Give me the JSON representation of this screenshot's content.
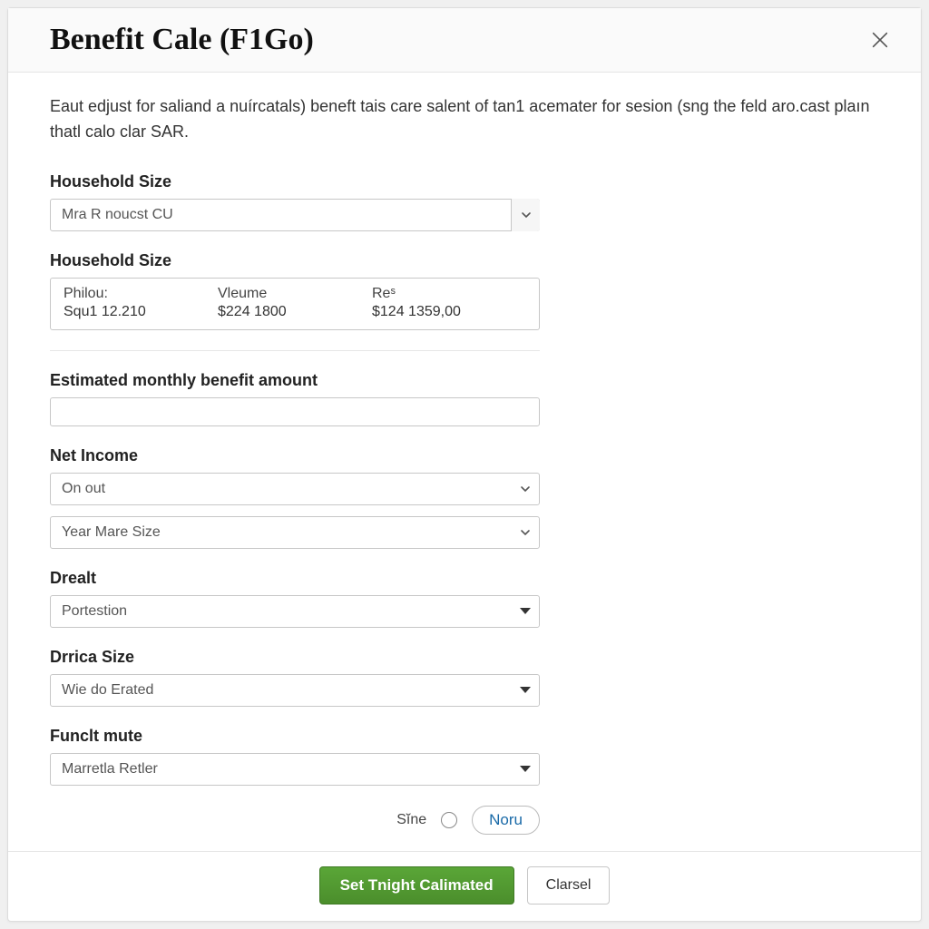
{
  "dialog": {
    "title": "Benefit Cale (F1Go)",
    "intro": "Eaut edjust for saliand a nuírcatals) beneft tais care salent of tan1 acemater for sesion (sng the feld aro.cast plaın thatl calo clar SAR."
  },
  "fields": {
    "household_size_1": {
      "label": "Household Size",
      "value": "Mra R noucst CU"
    },
    "household_size_2": {
      "label": "Household Size"
    },
    "estimated_benefit": {
      "label": "Estimated monthly benefit amount",
      "value": ""
    },
    "net_income": {
      "label": "Net Income",
      "value1": "On out",
      "value2": "Year Mare Size"
    },
    "drealt": {
      "label": "Drealt",
      "value": "Portestion"
    },
    "drrica_size": {
      "label": "Drrica Size",
      "value": "Wie do Erated"
    },
    "funclt_mute": {
      "label": "Funclt mute",
      "value": "Marretla Retler"
    }
  },
  "summary": {
    "col1": {
      "top": "Philou:",
      "bot": "Squ1 12.210"
    },
    "col2": {
      "top": "Vleume",
      "bot": "$224 1800"
    },
    "col3": {
      "top": "Reˢ",
      "bot": "$124 1359,00"
    }
  },
  "size_row": {
    "label": "Sĭne",
    "noru": "Noru"
  },
  "footer": {
    "primary": "Set Tnight Calimated",
    "secondary": "Clarsel"
  }
}
